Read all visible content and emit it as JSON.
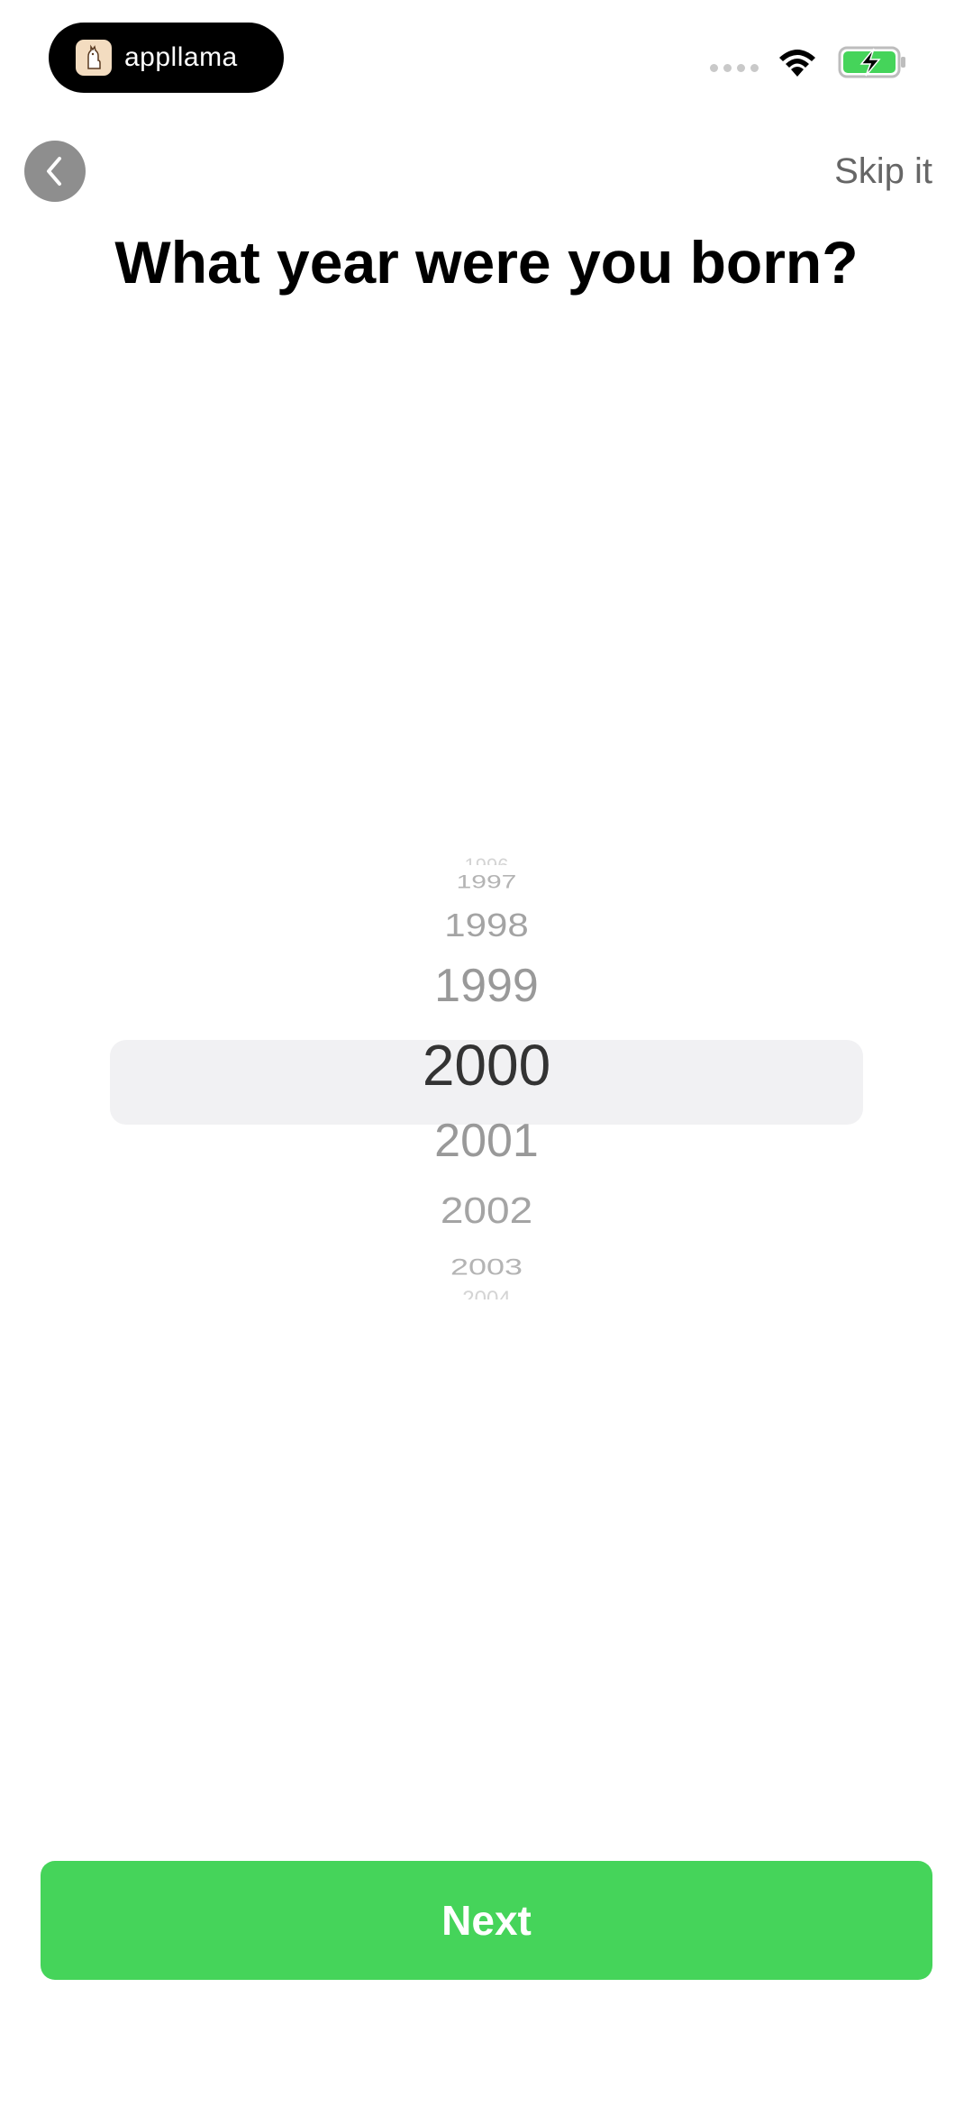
{
  "status_bar": {
    "app_name": "appllama",
    "icons": [
      "llama-logo-icon",
      "cellular-signal-icon",
      "wifi-icon",
      "battery-charging-icon"
    ]
  },
  "header": {
    "back_icon": "chevron-left-icon",
    "skip_label": "Skip it",
    "title": "What year were you born?"
  },
  "picker": {
    "years": [
      "1997",
      "1998",
      "1999",
      "2000",
      "2001",
      "2002",
      "2003"
    ],
    "cut_top": "1996",
    "cut_bottom": "2004",
    "selected": "2000"
  },
  "footer": {
    "next_label": "Next"
  },
  "colors": {
    "accent_green": "#45d45a",
    "back_button": "#8e8e8e",
    "highlight": "#f1f1f3"
  }
}
